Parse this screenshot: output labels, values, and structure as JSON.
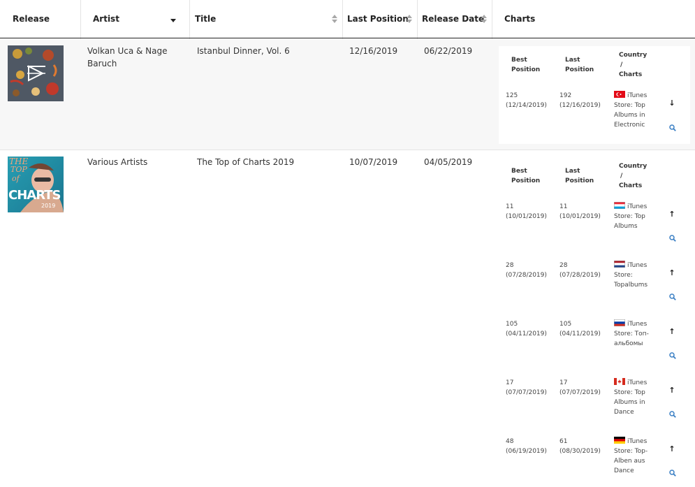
{
  "header": {
    "release": "Release",
    "artist": "Artist",
    "title": "Title",
    "last_position": "Last Position",
    "release_date": "Release Date",
    "charts": "Charts"
  },
  "chart_table_headers": {
    "best": [
      "Best",
      "Position"
    ],
    "last": [
      "Last",
      "Position"
    ],
    "country": [
      "Country",
      "/",
      "Charts"
    ]
  },
  "rows": [
    {
      "artist_lines": [
        "Volkan Uca & Nage",
        "Baruch"
      ],
      "title": "Istanbul Dinner, Vol. 6",
      "last_position": "12/16/2019",
      "release_date": "06/22/2019",
      "charts": [
        {
          "best": "125",
          "best_date": "(12/14/2019)",
          "last": "192",
          "last_date": "(12/16/2019)",
          "flag": "turkey",
          "lines": [
            "iTunes",
            "Store: Top",
            "Albums in",
            "Electronic"
          ],
          "trend": "down"
        }
      ]
    },
    {
      "artist_lines": [
        "Various Artists"
      ],
      "title": "The Top of Charts 2019",
      "last_position": "10/07/2019",
      "release_date": "04/05/2019",
      "cover_text": [
        "THE",
        "TOP",
        "of",
        "CHARTS",
        "2019"
      ],
      "charts": [
        {
          "best": "11",
          "best_date": "(10/01/2019)",
          "last": "11",
          "last_date": "(10/01/2019)",
          "flag": "luxembourg",
          "lines": [
            "iTunes",
            "Store: Top",
            "Albums"
          ],
          "trend": "up"
        },
        {
          "best": "28",
          "best_date": "(07/28/2019)",
          "last": "28",
          "last_date": "(07/28/2019)",
          "flag": "netherlands",
          "lines": [
            "iTunes",
            "Store:",
            "Topalbums"
          ],
          "trend": "up"
        },
        {
          "best": "105",
          "best_date": "(04/11/2019)",
          "last": "105",
          "last_date": "(04/11/2019)",
          "flag": "russia",
          "lines": [
            "iTunes",
            "Store: Топ-",
            "альбомы"
          ],
          "trend": "up"
        },
        {
          "best": "17",
          "best_date": "(07/07/2019)",
          "last": "17",
          "last_date": "(07/07/2019)",
          "flag": "canada",
          "lines": [
            "iTunes",
            "Store: Top",
            "Albums in",
            "Dance"
          ],
          "trend": "up"
        },
        {
          "best": "48",
          "best_date": "(06/19/2019)",
          "last": "61",
          "last_date": "(08/30/2019)",
          "flag": "germany",
          "lines": [
            "iTunes",
            "Store: Top-",
            "Alben aus",
            "Dance"
          ],
          "trend": "up"
        }
      ]
    }
  ],
  "icons": {
    "trend_up": "arrow-up-icon",
    "trend_down": "arrow-down-icon",
    "details": "magnifier-icon"
  },
  "colors": {
    "row_alt": "#f7f7f7",
    "magnifier": "#3a7fc4",
    "border": "#e4e4e4"
  }
}
